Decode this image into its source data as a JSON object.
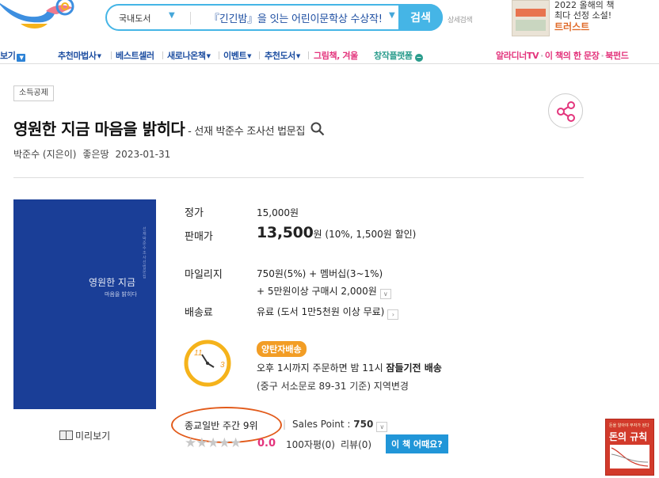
{
  "header": {
    "search": {
      "scope": "국내도서",
      "query": "『긴긴밤』을 잇는 어린이문학상 수상작!",
      "button": "검색",
      "advanced": "상세검색"
    },
    "ad": {
      "line1": "2022 올해의 책",
      "line2": "최다 선정 소설!",
      "line3": "트러스트"
    }
  },
  "nav": {
    "items": [
      "보기",
      "추천마법사",
      "베스트셀러",
      "새로나온책",
      "이벤트",
      "추천도서",
      "그림책, 겨울",
      "창작플랫폼"
    ],
    "right": [
      "알라디너TV",
      "이 책의 한 문장",
      "북펀드"
    ]
  },
  "product": {
    "badge": "소득공제",
    "title": "영원한 지금 마음을 밝히다",
    "subtitle": " - 선재 박준수 조사선 법문집",
    "author": "박준수 (지은이)",
    "publisher": "좋은땅",
    "date": "2023-01-31",
    "cover": {
      "title": "영원한 지금",
      "subtitle": "마음을 밝히다",
      "vertical": "선재 박준수 조사선 법문집"
    },
    "preview": "미리보기",
    "price": {
      "list_label": "정가",
      "list_value": "15,000원",
      "sale_label": "판매가",
      "sale_value": "13,500",
      "sale_unit": "원 (10%, 1,500원 할인)"
    },
    "mileage": {
      "label": "마일리지",
      "line1": "750원(5%) + 멤버십(3~1%)",
      "line2": "+ 5만원이상 구매시 2,000원"
    },
    "shipping": {
      "label": "배송료",
      "value": "유료 (도서 1만5천원 이상 무료)"
    },
    "delivery": {
      "badge": "양탄자배송",
      "line1_prefix": "오후 1시까지 주문하면 밤 11시 ",
      "line1_bold": "잠들기전 배송",
      "line2": "(중구 서소문로 89-31 기준) 지역변경",
      "clock_11": "11",
      "clock_3": "3"
    },
    "rank": "종교일반 주간 9위",
    "salespoint_label": "Sales Point : ",
    "salespoint_value": "750",
    "rating": {
      "score": "0.0",
      "stars": 0,
      "reviews_100": "100자평(0)",
      "reviews": "리뷰(0)",
      "button": "이 책 어때요?"
    }
  },
  "side_ad": {
    "title": "돈의 규칙",
    "tagline": "돈을 알아야 부자가 된다"
  },
  "colors": {
    "accent": "#45b5e6",
    "nav_blue": "#1d4ea1",
    "pink": "#e3347c",
    "cover_blue": "#1a3e97",
    "delivery_orange": "#f29d25",
    "rank_oval": "#e25b1b"
  }
}
